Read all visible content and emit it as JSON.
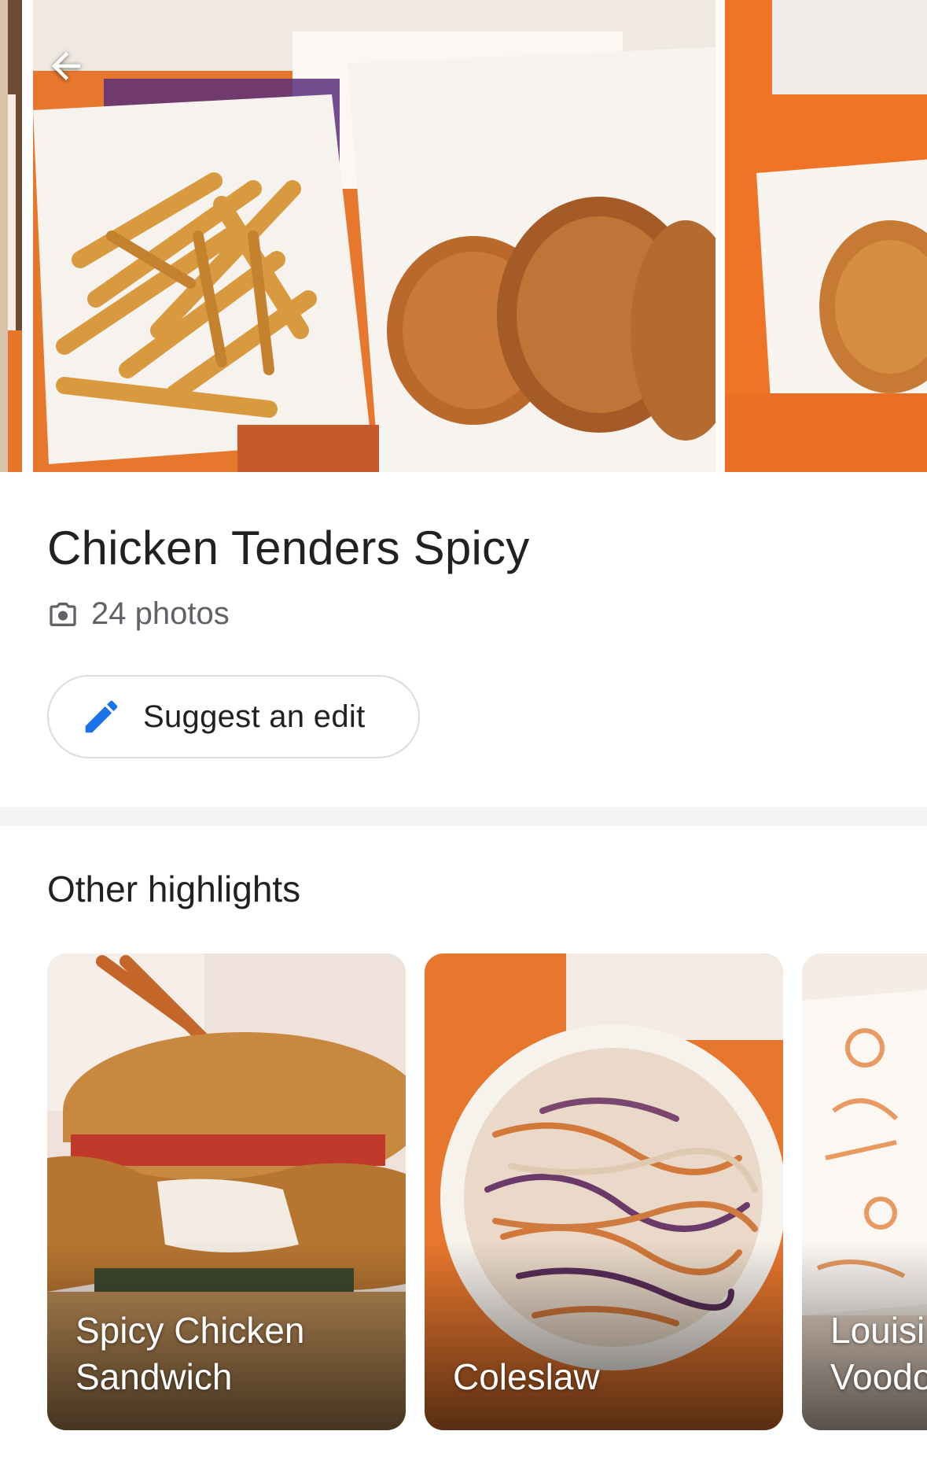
{
  "item": {
    "title": "Chicken Tenders Spicy",
    "photo_count": "24 photos",
    "suggest_edit_label": "Suggest an edit"
  },
  "carousel": {
    "photos": [
      {
        "subject": "partial-side-photo"
      },
      {
        "subject": "fries-and-fried-chicken"
      },
      {
        "subject": "chicken-tenders-box"
      }
    ]
  },
  "highlights": {
    "title": "Other highlights",
    "cards": [
      {
        "label": "Spicy Chicken\nSandwich"
      },
      {
        "label": "Coleslaw"
      },
      {
        "label": "Louisi\nVoodo"
      }
    ]
  },
  "colors": {
    "accent_blue": "#1a73e8",
    "text_primary": "#202124",
    "text_secondary": "#5f6368",
    "border": "#dadce0",
    "divider": "#f1f3f4",
    "brand_orange": "#f36f21"
  },
  "icons": {
    "back": "arrow-left-icon",
    "camera": "camera-icon",
    "edit": "pencil-icon"
  }
}
